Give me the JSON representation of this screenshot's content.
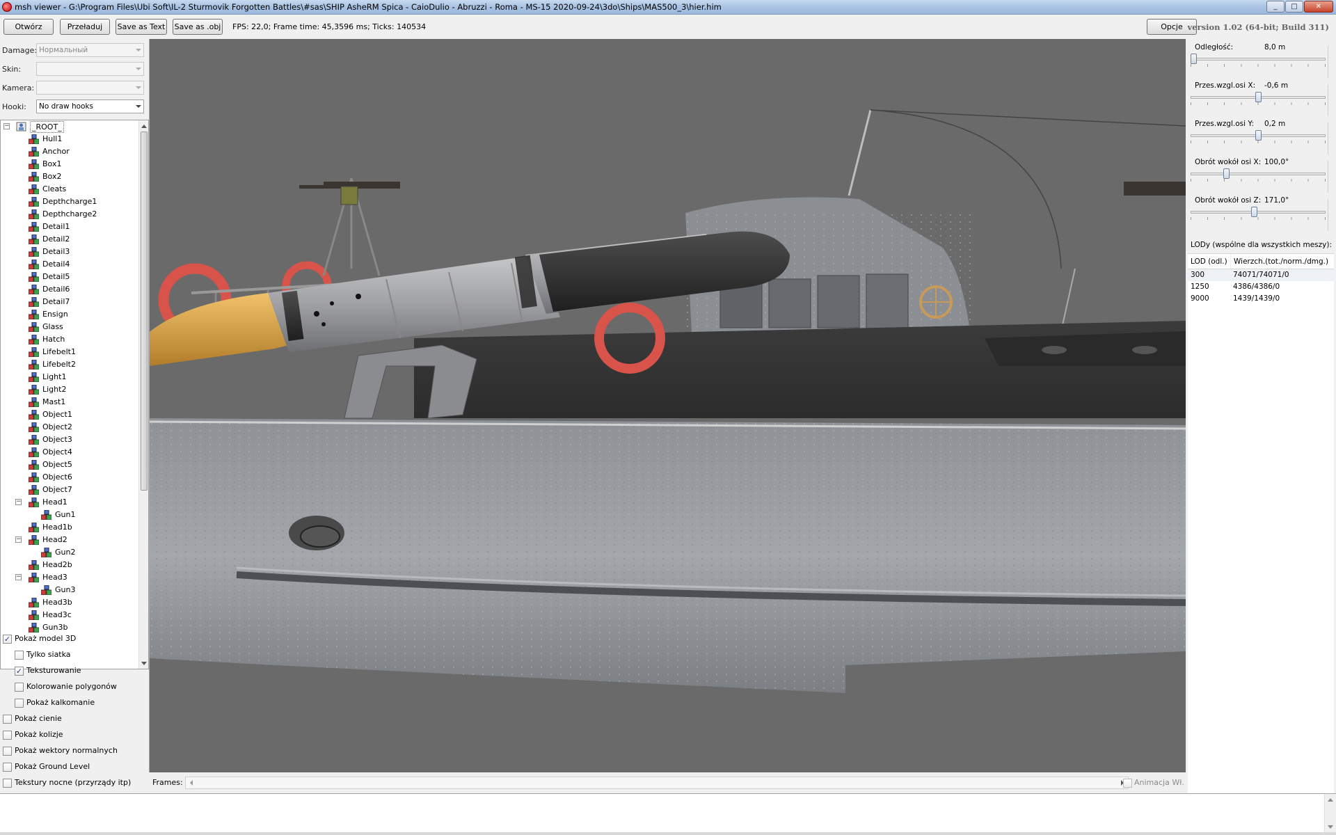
{
  "window": {
    "title": "msh viewer - G:\\Program Files\\Ubi Soft\\IL-2 Sturmovik Forgotten Battles\\#sas\\SHIP AsheRM Spica  - CaioDulio - Abruzzi - Roma - MS-15 2020-09-24\\3do\\Ships\\MAS500_3\\hier.him",
    "minimize": "_",
    "maximize": "□",
    "close": "✕"
  },
  "toolbar": {
    "open_label": "Otwórz",
    "reload_label": "Przeładuj",
    "save_text_label": "Save as Text",
    "save_obj_label": "Save as .obj",
    "fps_text": "FPS: 22,0; Frame time: 45,3596 ms; Ticks: 140534",
    "options_label": "Opcje",
    "version": "version 1.02 (64-bit; Build 311)"
  },
  "fields": {
    "damage_label": "Damage:",
    "damage_value": "Нормальный",
    "skin_label": "Skin:",
    "skin_value": "",
    "camera_label": "Kamera:",
    "camera_value": "",
    "hooks_label": "Hooki:",
    "hooks_value": "No draw hooks"
  },
  "tree": {
    "root": "_ROOT_",
    "items": [
      {
        "label": "Hull1",
        "level": 1
      },
      {
        "label": "Anchor",
        "level": 1
      },
      {
        "label": "Box1",
        "level": 1
      },
      {
        "label": "Box2",
        "level": 1
      },
      {
        "label": "Cleats",
        "level": 1
      },
      {
        "label": "Depthcharge1",
        "level": 1
      },
      {
        "label": "Depthcharge2",
        "level": 1
      },
      {
        "label": "Detail1",
        "level": 1
      },
      {
        "label": "Detail2",
        "level": 1
      },
      {
        "label": "Detail3",
        "level": 1
      },
      {
        "label": "Detail4",
        "level": 1
      },
      {
        "label": "Detail5",
        "level": 1
      },
      {
        "label": "Detail6",
        "level": 1
      },
      {
        "label": "Detail7",
        "level": 1
      },
      {
        "label": "Ensign",
        "level": 1
      },
      {
        "label": "Glass",
        "level": 1
      },
      {
        "label": "Hatch",
        "level": 1
      },
      {
        "label": "Lifebelt1",
        "level": 1
      },
      {
        "label": "Lifebelt2",
        "level": 1
      },
      {
        "label": "Light1",
        "level": 1
      },
      {
        "label": "Light2",
        "level": 1
      },
      {
        "label": "Mast1",
        "level": 1
      },
      {
        "label": "Object1",
        "level": 1
      },
      {
        "label": "Object2",
        "level": 1
      },
      {
        "label": "Object3",
        "level": 1
      },
      {
        "label": "Object4",
        "level": 1
      },
      {
        "label": "Object5",
        "level": 1
      },
      {
        "label": "Object6",
        "level": 1
      },
      {
        "label": "Object7",
        "level": 1
      },
      {
        "label": "Head1",
        "level": 1,
        "expanded": true
      },
      {
        "label": "Gun1",
        "level": 2
      },
      {
        "label": "Head1b",
        "level": 1
      },
      {
        "label": "Head2",
        "level": 1,
        "expanded": true
      },
      {
        "label": "Gun2",
        "level": 2
      },
      {
        "label": "Head2b",
        "level": 1
      },
      {
        "label": "Head3",
        "level": 1,
        "expanded": true
      },
      {
        "label": "Gun3",
        "level": 2
      },
      {
        "label": "Head3b",
        "level": 1
      },
      {
        "label": "Head3c",
        "level": 1
      },
      {
        "label": "Gun3b",
        "level": 1
      }
    ]
  },
  "options": [
    {
      "label": "Pokaż model 3D",
      "checked": true,
      "indent": 0
    },
    {
      "label": "Tylko siatka",
      "checked": false,
      "indent": 1
    },
    {
      "label": "Teksturowanie",
      "checked": true,
      "indent": 1
    },
    {
      "label": "Kolorowanie polygonów",
      "checked": false,
      "indent": 1
    },
    {
      "label": "Pokaż kalkomanie",
      "checked": false,
      "indent": 1
    },
    {
      "label": "Pokaż cienie",
      "checked": false,
      "indent": 0
    },
    {
      "label": "Pokaż kolizje",
      "checked": false,
      "indent": 0
    },
    {
      "label": "Pokaż wektory normalnych",
      "checked": false,
      "indent": 0
    },
    {
      "label": "Pokaż Ground Level",
      "checked": false,
      "indent": 0
    },
    {
      "label": "Tekstury nocne (przyrządy itp)",
      "checked": false,
      "indent": 0
    }
  ],
  "frames": {
    "label": "Frames:",
    "animation_label": "Animacja Wł."
  },
  "camera_sliders": [
    {
      "label": "Odległość:",
      "value": "8,0 m",
      "level": 0.0
    },
    {
      "label": "Przes.wzgl.osi X:",
      "value": "-0,6 m",
      "level": 0.5
    },
    {
      "label": "Przes.wzgl.osi Y:",
      "value": "0,2 m",
      "level": 0.5
    },
    {
      "label": "Obrót wokół osi X:",
      "value": "100,0°",
      "level": 0.25
    },
    {
      "label": "Obrót wokół osi Z:",
      "value": "171,0°",
      "level": 0.47
    }
  ],
  "lod": {
    "title": "LODy (wspólne dla wszystkich meszy):",
    "columns": [
      "LOD (odl.)",
      "Wierzch.(tot./norm./dmg.)"
    ],
    "rows": [
      [
        "300",
        "74071/74071/0"
      ],
      [
        "1250",
        "4386/4386/0"
      ],
      [
        "9000",
        "1439/1439/0"
      ]
    ]
  },
  "colors": {
    "viewport_bg": "#6a6a6a",
    "hull": "#9a9ea3",
    "torpedo_warhead": "#e0a64a",
    "torpedo_body": "#a9aaad",
    "torpedo_nose": "#3a3a3a",
    "lifebelt": "#d8544a"
  }
}
